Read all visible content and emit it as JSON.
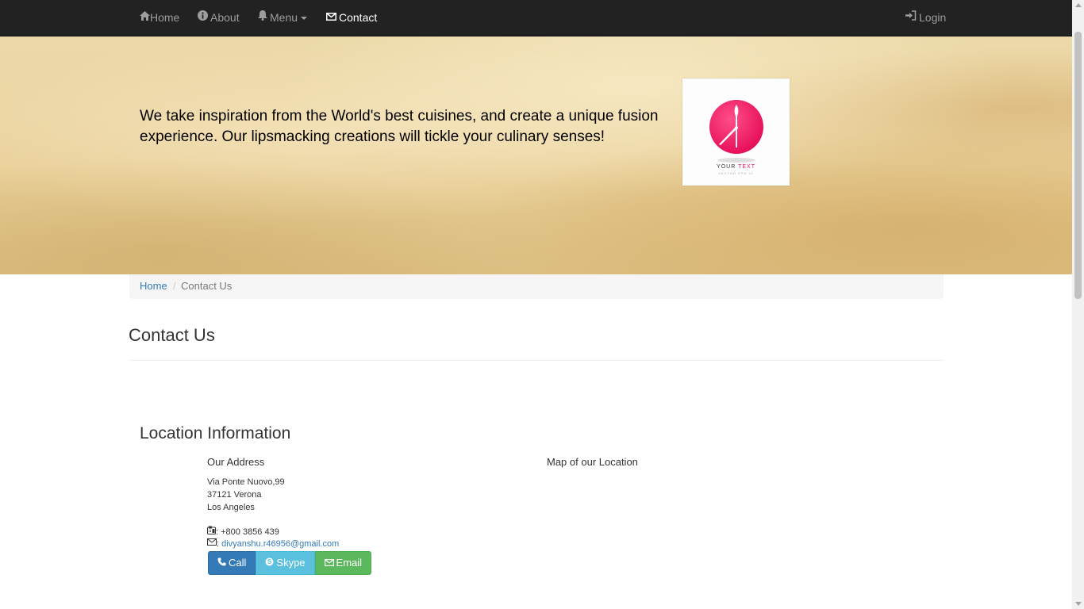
{
  "navbar": {
    "items": [
      {
        "label": "Home",
        "icon": "home-icon"
      },
      {
        "label": "About",
        "icon": "info-icon"
      },
      {
        "label": "Menu",
        "icon": "bell-icon"
      },
      {
        "label": "Contact",
        "icon": "envelope-icon",
        "active": true
      }
    ],
    "login": {
      "label": "Login",
      "icon": "login-icon"
    }
  },
  "jumbotron": {
    "tagline": "We take inspiration from the World's best cuisines, and create a unique fusion experience. Our lipsmacking creations will tickle your culinary senses!",
    "logo": {
      "text_main": "YOUR ",
      "text_accent": "TEXT",
      "text_sub": "VECTOR EPS 10"
    }
  },
  "breadcrumb": {
    "home": "Home",
    "separator": "/",
    "current": "Contact Us"
  },
  "page_title": "Contact Us",
  "location": {
    "title": "Location Information",
    "address_heading": "Our Address",
    "address_lines": [
      "Via Ponte Nuovo,99",
      "37121 Verona",
      "Los Angeles"
    ],
    "phone": ": +800 3856 439",
    "email_prefix": ":",
    "email": "divyanshu.r46956@gmail.com",
    "map_heading": "Map of our Location"
  },
  "buttons": {
    "call": "Call",
    "skype": "Skype",
    "email": "Email"
  },
  "colors": {
    "navbar": "#222222",
    "link": "#337ab7",
    "call": "#337ab7",
    "skype": "#5bc0de",
    "email": "#5cb85c",
    "logo_pink": "#e8125c"
  }
}
